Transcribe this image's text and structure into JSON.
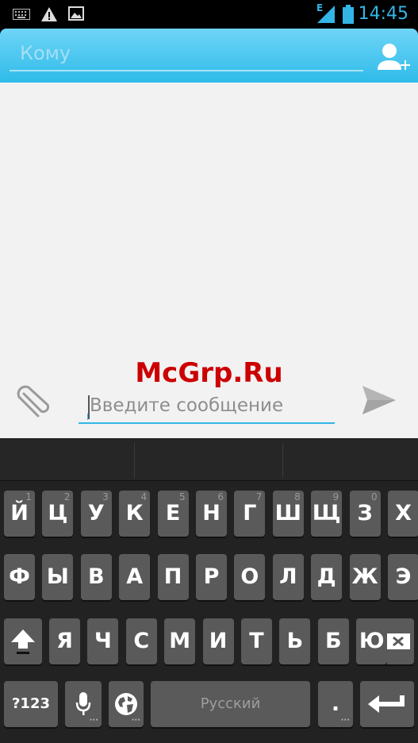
{
  "status_bar": {
    "time": "14:45",
    "network_label": "E",
    "icons": [
      "keyboard-icon",
      "warning-icon",
      "image-icon",
      "signal-icon",
      "battery-icon"
    ]
  },
  "header": {
    "to_placeholder": "Кому",
    "add_contact_icon": "add-contact-icon"
  },
  "conversation": {
    "watermark": "McGrp.Ru",
    "message_placeholder": "Введите сообщение",
    "attach_icon": "paperclip-icon",
    "send_icon": "send-icon"
  },
  "keyboard": {
    "row1": [
      {
        "label": "Й",
        "hint": "1"
      },
      {
        "label": "Ц",
        "hint": "2"
      },
      {
        "label": "У",
        "hint": "3"
      },
      {
        "label": "К",
        "hint": "4"
      },
      {
        "label": "Е",
        "hint": "5"
      },
      {
        "label": "Н",
        "hint": "6"
      },
      {
        "label": "Г",
        "hint": "7"
      },
      {
        "label": "Ш",
        "hint": "8"
      },
      {
        "label": "Щ",
        "hint": "9"
      },
      {
        "label": "З",
        "hint": "0"
      },
      {
        "label": "Х",
        "hint": ""
      }
    ],
    "row2": [
      "Ф",
      "Ы",
      "В",
      "А",
      "П",
      "Р",
      "О",
      "Л",
      "Д",
      "Ж",
      "Э"
    ],
    "row3": [
      "Я",
      "Ч",
      "С",
      "М",
      "И",
      "Т",
      "Ь",
      "Б",
      "Ю"
    ],
    "symbols_label": "?123",
    "space_label": "Русский",
    "period_label": ".",
    "colors": {
      "key": "#5a5a5a",
      "accent": "#33b5e5"
    }
  }
}
